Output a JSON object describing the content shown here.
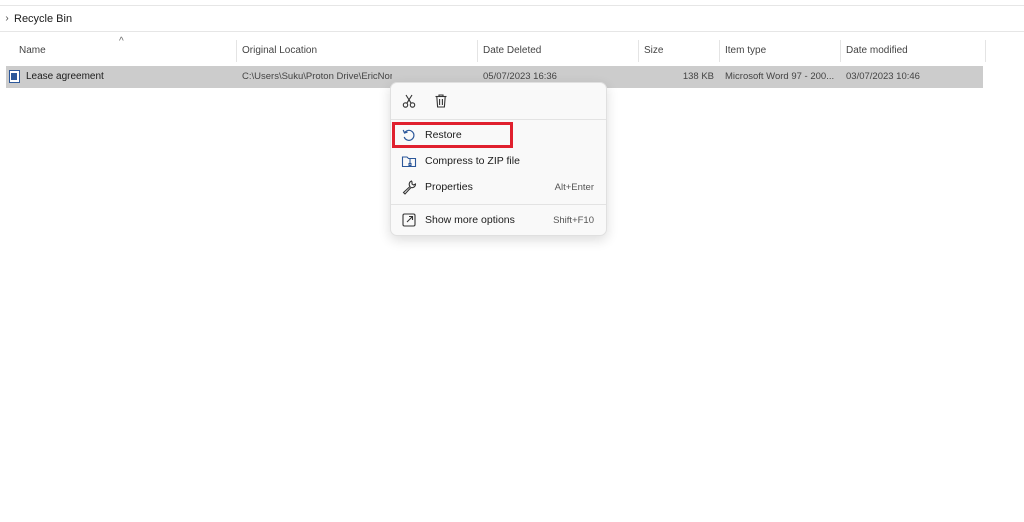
{
  "breadcrumb": {
    "chevron": "›",
    "label": "Recycle Bin"
  },
  "columns": [
    {
      "label": "Name"
    },
    {
      "label": "Original Location"
    },
    {
      "label": "Date Deleted"
    },
    {
      "label": "Size"
    },
    {
      "label": "Item type"
    },
    {
      "label": "Date modified"
    }
  ],
  "sort_caret": "^",
  "file": {
    "icon": "word-document-icon",
    "name": "Lease agreement",
    "original_location": "C:\\Users\\Suku\\Proton Drive\\EricNorbert\\My files",
    "date_deleted": "05/07/2023 16:36",
    "size": "138 KB",
    "item_type": "Microsoft Word 97 - 200...",
    "date_modified": "03/07/2023 10:46"
  },
  "context_menu": {
    "quick_actions": [
      {
        "icon": "scissors-icon",
        "name": "cut"
      },
      {
        "icon": "trash-icon",
        "name": "delete"
      }
    ],
    "items": [
      {
        "icon": "restore-icon",
        "label": "Restore",
        "shortcut": ""
      },
      {
        "icon": "zip-folder-icon",
        "label": "Compress to ZIP file",
        "shortcut": ""
      },
      {
        "icon": "wrench-icon",
        "label": "Properties",
        "shortcut": "Alt+Enter"
      },
      {
        "icon": "show-more-icon",
        "label": "Show more options",
        "shortcut": "Shift+F10"
      }
    ]
  },
  "colors": {
    "selected_row": "#cccccc",
    "highlight_box": "#e0202e",
    "icon_blue": "#2b579a"
  }
}
